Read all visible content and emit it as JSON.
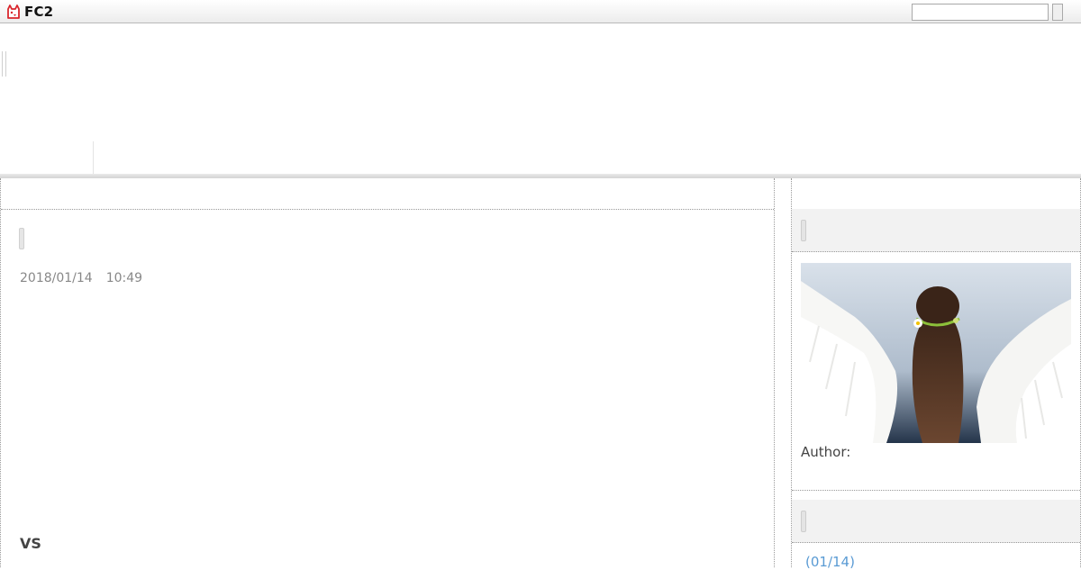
{
  "topbar": {
    "logo_text": "FC2",
    "logo_icon": "fc2-fox-icon",
    "search": {
      "value": "",
      "placeholder": ""
    }
  },
  "entry": {
    "date": "2018/01/14",
    "time": "10:49",
    "vs_text": "VS"
  },
  "sidebar": {
    "profile": {
      "image": "angel-wings-photo",
      "author_label": "Author:"
    },
    "recent": {
      "link_text": "(01/14)"
    }
  },
  "colors": {
    "link": "#5a9bd4",
    "meta_text": "#888888",
    "logo_red": "#d9262c"
  }
}
